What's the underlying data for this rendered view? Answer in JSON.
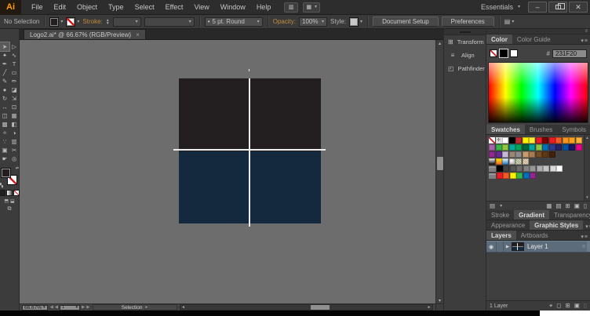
{
  "icons": {
    "dropdown": "▾",
    "up": "▴",
    "down": "▾",
    "left": "◂",
    "right": "▸",
    "prev": "◀",
    "next": "▶",
    "close": "✕",
    "tab_close": "×",
    "minimize": "–",
    "menu": "≡",
    "bullet": "•",
    "expand": "▶",
    "bridge": "▥",
    "arrange_documents": "▦",
    "align_options": "▤",
    "stepper_up": "▲",
    "stepper_down": "▼",
    "target_circle": "○",
    "collapse_dock": "◂◂"
  },
  "titlebar": {
    "logo": "Ai",
    "menus": [
      "File",
      "Edit",
      "Object",
      "Type",
      "Select",
      "Effect",
      "View",
      "Window",
      "Help"
    ],
    "workspace_label": "Essentials"
  },
  "controlbar": {
    "no_selection": "No Selection",
    "stroke_label": "Stroke:",
    "brush_value": "5 pt. Round",
    "opacity_label": "Opacity:",
    "opacity_value": "100%",
    "style_label": "Style:",
    "document_setup": "Document Setup",
    "preferences": "Preferences",
    "fill_color": "#231F20"
  },
  "document_tab": {
    "title": "Logo2.ai* @ 66.67% (RGB/Preview)"
  },
  "toolbar": {
    "tools": [
      {
        "name": "selection",
        "glyph": "➤",
        "active": true
      },
      {
        "name": "direct-selection",
        "glyph": "▷"
      },
      {
        "name": "magic-wand",
        "glyph": "✦"
      },
      {
        "name": "lasso",
        "glyph": "∿"
      },
      {
        "name": "pen",
        "glyph": "✒"
      },
      {
        "name": "type",
        "glyph": "T"
      },
      {
        "name": "line-segment",
        "glyph": "╱"
      },
      {
        "name": "rectangle",
        "glyph": "▭"
      },
      {
        "name": "paintbrush",
        "glyph": "✎"
      },
      {
        "name": "pencil",
        "glyph": "✏"
      },
      {
        "name": "blob-brush",
        "glyph": "●"
      },
      {
        "name": "eraser",
        "glyph": "◪"
      },
      {
        "name": "rotate",
        "glyph": "↻"
      },
      {
        "name": "scale",
        "glyph": "⇲"
      },
      {
        "name": "width",
        "glyph": "↔"
      },
      {
        "name": "free-transform",
        "glyph": "⊡"
      },
      {
        "name": "shape-builder",
        "glyph": "◫"
      },
      {
        "name": "perspective-grid",
        "glyph": "▦"
      },
      {
        "name": "mesh",
        "glyph": "▩"
      },
      {
        "name": "gradient",
        "glyph": "◧"
      },
      {
        "name": "eyedropper",
        "glyph": "✧"
      },
      {
        "name": "blend",
        "glyph": "◑"
      },
      {
        "name": "symbol-sprayer",
        "glyph": "∵"
      },
      {
        "name": "column-graph",
        "glyph": "▥"
      },
      {
        "name": "artboard",
        "glyph": "▣"
      },
      {
        "name": "slice",
        "glyph": "✂"
      },
      {
        "name": "hand",
        "glyph": "☛"
      },
      {
        "name": "zoom",
        "glyph": "◎"
      }
    ],
    "fill_color": "#231F20",
    "paint_buttons": [
      {
        "name": "paint-color",
        "fill": "#231F20"
      },
      {
        "name": "paint-gradient",
        "fill": "gradient"
      },
      {
        "name": "paint-none",
        "fill": "none"
      }
    ],
    "drawing_modes": [
      "⬒",
      "⬓"
    ],
    "screen_mode_glyph": "⧉"
  },
  "canvas": {
    "background": "#6d6d6d",
    "artwork": {
      "top_color": "#231F20",
      "bottom_color": "#15293E",
      "line_color": "#ededeb"
    }
  },
  "dock": {
    "items": [
      {
        "name": "transform",
        "label": "Transform",
        "glyph": "⊞"
      },
      {
        "name": "align",
        "label": "Align",
        "glyph": "≡"
      },
      {
        "name": "pathfinder",
        "label": "Pathfinder",
        "glyph": "◰"
      }
    ]
  },
  "panels": {
    "color": {
      "tabs": [
        "Color",
        "Color Guide"
      ],
      "hex_label": "#",
      "hex_value": "231F20",
      "mini_swatches": [
        "none",
        "#000000",
        "#ffffff"
      ]
    },
    "swatch_tabs": [
      "Swatches",
      "Brushes",
      "Symbols"
    ],
    "swatches": {
      "rows": [
        [
          "none",
          "reg",
          "#ffffff",
          "#000000",
          "#c1272d",
          "#fff200",
          "#f9ed32",
          "#ed1c24",
          "#790000",
          "#ed1c24",
          "#f15a24",
          "#f7941e",
          "#f9a01b",
          "#fbb03b"
        ],
        [
          "#a864a8",
          "#39b54a",
          "#8dc63f",
          "#00a99d",
          "#00a651",
          "#006838",
          "#00a79d",
          "#8dc63f",
          "#0072bc",
          "#2b3990",
          "#262262",
          "#0054a6",
          "#1b1464",
          "#ec008c"
        ],
        [
          "#92278f",
          "#662d91",
          "#c7b9d5",
          "#998675",
          "#8c8c8c",
          "#c69c6d",
          "#a67c52",
          "#754c24",
          "#603913",
          "#42210b"
        ],
        [
          "grad-v:#ffffff>#000000",
          "grad-v:#fff200>#f15a24",
          "grad-v:#ffffff>#1b75bc",
          "grad-r:#ffffff>#8c8c8c",
          "pat:#96a876",
          "pat:#c4a47c"
        ],
        [
          "folder",
          "#000000",
          "#404040",
          "#565656",
          "#6c6c6c",
          "#828282",
          "#989898",
          "#aeaeae",
          "#c4c4c4",
          "#dadada",
          "#ffffff"
        ],
        [
          "folder",
          "#ed1c24",
          "#f15a24",
          "#fff200",
          "#39b54a",
          "#0072bc",
          "#92278f"
        ]
      ],
      "footer_left": [
        {
          "name": "swatch-libraries-menu",
          "glyph": "▤"
        }
      ],
      "footer_right": [
        {
          "name": "show-swatch-kinds-menu",
          "glyph": "▦"
        },
        {
          "name": "swatch-options",
          "glyph": "▤"
        },
        {
          "name": "new-color-group",
          "glyph": "⊞"
        },
        {
          "name": "new-swatch",
          "glyph": "▣"
        },
        {
          "name": "delete-swatch",
          "glyph": "▯"
        }
      ]
    },
    "stroke_group": {
      "tabs": [
        "Stroke",
        "Gradient",
        "Transparency"
      ],
      "active": 1
    },
    "appearance_group": {
      "tabs": [
        "Appearance",
        "Graphic Styles"
      ],
      "active": 1
    },
    "layers_group": {
      "tabs": [
        "Layers",
        "Artboards"
      ],
      "active": 0
    },
    "layers": {
      "layer_name": "Layer 1",
      "count_label": "1 Layer",
      "footer_icons": [
        {
          "name": "locate-object",
          "glyph": "⌖"
        },
        {
          "name": "make-clipping-mask",
          "glyph": "◻"
        },
        {
          "name": "new-sublayer",
          "glyph": "⊞"
        },
        {
          "name": "new-layer",
          "glyph": "▣"
        },
        {
          "name": "delete-layer",
          "glyph": "▯",
          "dim": true
        }
      ]
    }
  },
  "statusbar": {
    "zoom": "66.67%",
    "artboard": "1",
    "status": "Selection"
  }
}
